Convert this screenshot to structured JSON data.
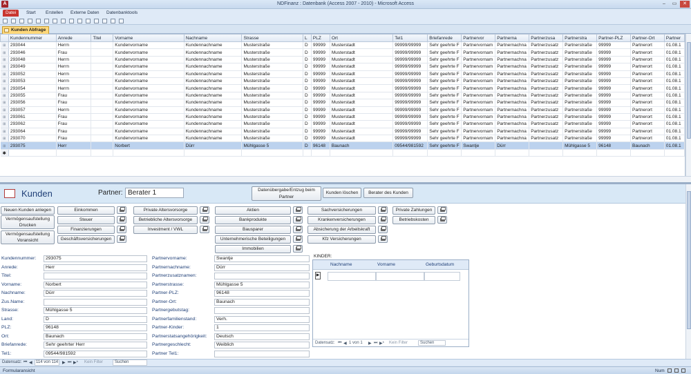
{
  "window": {
    "title": "NDFinanz : Datenbank (Access 2007 - 2010) - Microsoft Access",
    "app_icon": "A",
    "controls": {
      "minimize": "–",
      "maximize": "▭",
      "close": "✕"
    }
  },
  "ribbon": {
    "tabs": [
      "Datei",
      "Start",
      "Erstellen",
      "Externe Daten",
      "Datenbanktools"
    ]
  },
  "object_tab": {
    "label": "Kunden Abfrage"
  },
  "datasheet": {
    "columns": [
      "Kundennummer",
      "Anrede",
      "Titel",
      "Vorname",
      "Nachname",
      "Strasse",
      "L",
      "PLZ",
      "Ort",
      "Tel1",
      "Briefanrede",
      "Partnervor",
      "Partnerna",
      "Partnerzusa",
      "Partnerstra",
      "Partner-PLZ",
      "Partner-Ort",
      "Partner"
    ],
    "rows": [
      [
        "293044",
        "Herrn",
        "",
        "Kundenvorname",
        "Kundennachname",
        "Musterstraße",
        "D",
        "99999",
        "Musterstadt",
        "99999/99999",
        "Sehr geehrte F",
        "Partnervornam",
        "Partnernachna",
        "Partnerzusatz",
        "Partnerstraße",
        "99999",
        "Partnerort",
        "01.08.1"
      ],
      [
        "293046",
        "Frau",
        "",
        "Kundenvorname",
        "Kundennachname",
        "Musterstraße",
        "D",
        "99999",
        "Musterstadt",
        "99999/99999",
        "Sehr geehrte F",
        "Partnervornam",
        "Partnernachna",
        "Partnerzusatz",
        "Partnerstraße",
        "99999",
        "Partnerort",
        "01.08.1"
      ],
      [
        "293048",
        "Herrn",
        "",
        "Kundenvorname",
        "Kundennachname",
        "Musterstraße",
        "D",
        "99999",
        "Musterstadt",
        "99999/99999",
        "Sehr geehrte F",
        "Partnervornam",
        "Partnernachna",
        "Partnerzusatz",
        "Partnerstraße",
        "99999",
        "Partnerort",
        "01.08.1"
      ],
      [
        "293049",
        "Herrn",
        "",
        "Kundenvorname",
        "Kundennachname",
        "Musterstraße",
        "D",
        "99999",
        "Musterstadt",
        "99999/99999",
        "Sehr geehrte F",
        "Partnervornam",
        "Partnernachna",
        "Partnerzusatz",
        "Partnerstraße",
        "99999",
        "Partnerort",
        "01.08.1"
      ],
      [
        "293052",
        "Herrn",
        "",
        "Kundenvorname",
        "Kundennachname",
        "Musterstraße",
        "D",
        "99999",
        "Musterstadt",
        "99999/99999",
        "Sehr geehrte F",
        "Partnervornam",
        "Partnernachna",
        "Partnerzusatz",
        "Partnerstraße",
        "99999",
        "Partnerort",
        "01.08.1"
      ],
      [
        "293053",
        "Herrn",
        "",
        "Kundenvorname",
        "Kundennachname",
        "Musterstraße",
        "D",
        "99999",
        "Musterstadt",
        "99999/99999",
        "Sehr geehrte F",
        "Partnervornam",
        "Partnernachna",
        "Partnerzusatz",
        "Partnerstraße",
        "99999",
        "Partnerort",
        "01.08.1"
      ],
      [
        "293054",
        "Herrn",
        "",
        "Kundenvorname",
        "Kundennachname",
        "Musterstraße",
        "D",
        "99999",
        "Musterstadt",
        "99999/99999",
        "Sehr geehrte F",
        "Partnervornam",
        "Partnernachna",
        "Partnerzusatz",
        "Partnerstraße",
        "99999",
        "Partnerort",
        "01.08.1"
      ],
      [
        "293055",
        "Frau",
        "",
        "Kundenvorname",
        "Kundennachname",
        "Musterstraße",
        "D",
        "99999",
        "Musterstadt",
        "99999/99999",
        "Sehr geehrte F",
        "Partnervornam",
        "Partnernachna",
        "Partnerzusatz",
        "Partnerstraße",
        "99999",
        "Partnerort",
        "01.08.1"
      ],
      [
        "293056",
        "Frau",
        "",
        "Kundenvorname",
        "Kundennachname",
        "Musterstraße",
        "D",
        "99999",
        "Musterstadt",
        "99999/99999",
        "Sehr geehrte F",
        "Partnervornam",
        "Partnernachna",
        "Partnerzusatz",
        "Partnerstraße",
        "99999",
        "Partnerort",
        "01.08.1"
      ],
      [
        "293057",
        "Herrn",
        "",
        "Kundenvorname",
        "Kundennachname",
        "Musterstraße",
        "D",
        "99999",
        "Musterstadt",
        "99999/99999",
        "Sehr geehrte F",
        "Partnervornam",
        "Partnernachna",
        "Partnerzusatz",
        "Partnerstraße",
        "99999",
        "Partnerort",
        "01.08.1"
      ],
      [
        "293061",
        "Frau",
        "",
        "Kundenvorname",
        "Kundennachname",
        "Musterstraße",
        "D",
        "99999",
        "Musterstadt",
        "99999/99999",
        "Sehr geehrte F",
        "Partnervornam",
        "Partnernachna",
        "Partnerzusatz",
        "Partnerstraße",
        "99999",
        "Partnerort",
        "01.08.1"
      ],
      [
        "293062",
        "Frau",
        "",
        "Kundenvorname",
        "Kundennachname",
        "Musterstraße",
        "D",
        "99999",
        "Musterstadt",
        "99999/99999",
        "Sehr geehrte F",
        "Partnervornam",
        "Partnernachna",
        "Partnerzusatz",
        "Partnerstraße",
        "99999",
        "Partnerort",
        "01.08.1"
      ],
      [
        "293064",
        "Frau",
        "",
        "Kundenvorname",
        "Kundennachname",
        "Musterstraße",
        "D",
        "99999",
        "Musterstadt",
        "99999/99999",
        "Sehr geehrte F",
        "Partnervornam",
        "Partnernachna",
        "Partnerzusatz",
        "Partnerstraße",
        "99999",
        "Partnerort",
        "01.08.1"
      ],
      [
        "293070",
        "Frau",
        "",
        "Kundenvorname",
        "Kundennachname",
        "Musterstraße",
        "D",
        "99999",
        "Musterstadt",
        "99999/99999",
        "Sehr geehrte F",
        "Partnervornam",
        "Partnernachna",
        "Partnerzusatz",
        "Partnerstraße",
        "99999",
        "Partnerort",
        "01.08.1"
      ],
      [
        "293075",
        "Herr",
        "",
        "Norbert",
        "Dürr",
        "Mühlgasse 5",
        "D",
        "96148",
        "Baunach",
        "09544/981592",
        "Sehr geehrte F",
        "Swantje",
        "Dürr",
        "",
        "Mühlgasse 5",
        "96148",
        "Baunach",
        "01.08.1"
      ]
    ],
    "selected_index": 14
  },
  "form": {
    "title": "Kunden",
    "partner_label": "Partner:",
    "partner_value": "Berater 1",
    "header_buttons": [
      "Datenübergabe/Entzug beim Partner",
      "Kunden löschen",
      "Berater des Kunden"
    ],
    "left_buttons": [
      "Neuen Kunden anlegen",
      "Vermögensaufstellung Drucken",
      "Vermögensaufstellung Voransicht"
    ],
    "col1_buttons": [
      "Einkommen",
      "Steuer",
      "Finanzierungen",
      "Geschäftsversicherungen"
    ],
    "col2_buttons": [
      "Private Altersvorsorge",
      "Betriebliche Altersvorsorge",
      "Investment / VWL"
    ],
    "col3_buttons": [
      "Aktien",
      "Bankprodukte",
      "Bausparer",
      "Unternehmerische Beteiligungen",
      "Immobilien"
    ],
    "col4_buttons": [
      "Sachversicherungen",
      "Krankenversicherungen",
      "Absicherung der Arbeitskraft",
      "Kfz Versicherungen"
    ],
    "col5_buttons": [
      "Private Zahlungen",
      "Betriebskosten"
    ],
    "fields_left": [
      {
        "label": "Kundennummer:",
        "value": "293075"
      },
      {
        "label": "Anrede:",
        "value": "Herr"
      },
      {
        "label": "Titel:",
        "value": ""
      },
      {
        "label": "Vorname:",
        "value": "Norbert"
      },
      {
        "label": "Nachname:",
        "value": "Dürr"
      },
      {
        "label": "Zus.Name:",
        "value": ""
      },
      {
        "label": "Strasse:",
        "value": "Mühlgasse 5"
      },
      {
        "label": "Land:",
        "value": "D"
      },
      {
        "label": "PLZ:",
        "value": "96148"
      },
      {
        "label": "Ort:",
        "value": "Baunach"
      },
      {
        "label": "Briefanrede:",
        "value": "Sehr geehrter Herr"
      },
      {
        "label": "Tel1:",
        "value": "09544/981592"
      }
    ],
    "fields_right": [
      {
        "label": "Partnervorname:",
        "value": "Swantje"
      },
      {
        "label": "Partnernachname:",
        "value": "Dürr"
      },
      {
        "label": "Partnerzusatznamen:",
        "value": ""
      },
      {
        "label": "Partnerstrasse:",
        "value": "Mühlgasse 5"
      },
      {
        "label": "Partner-PLZ:",
        "value": "96148"
      },
      {
        "label": "Partner-Ort:",
        "value": "Baunach"
      },
      {
        "label": "Partnergebutstag:",
        "value": ""
      },
      {
        "label": "Partnerfamilienstand:",
        "value": "Verh."
      },
      {
        "label": "Partner-Kinder:",
        "value": "1"
      },
      {
        "label": "Partnerstatsangehörigkeit:",
        "value": "Deutsch"
      },
      {
        "label": "Partnergeschlecht:",
        "value": "Weiblich"
      },
      {
        "label": "Partner Tel1:",
        "value": ""
      }
    ],
    "kinder": {
      "title": "KINDER:",
      "columns": [
        "Nachname",
        "Vorname",
        "Geburtsdatum"
      ],
      "nav_label": "Datensatz:",
      "nav_position": "1 von 1",
      "filter": "Kein Filter",
      "search": "Suchen"
    }
  },
  "record_nav": {
    "label": "Datensatz:",
    "position": "114 von 114",
    "filter": "Kein Filter",
    "search": "Suchen"
  },
  "status": {
    "left": "Formularansicht",
    "num": "Num"
  }
}
